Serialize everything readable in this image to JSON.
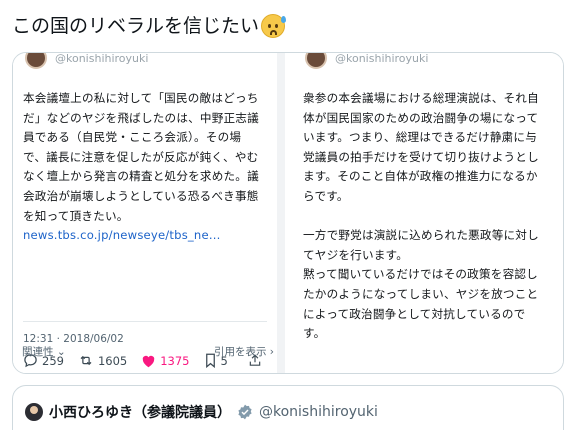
{
  "post": {
    "title": "この国のリベラルを信じたい",
    "emoji": "anxious-face-with-sweat"
  },
  "left_tweet": {
    "handle": "@konishihiroyuki",
    "lines": [
      "本会議壇上の私に対して「国民の敵はどっち",
      "だ」などのヤジを飛ばしたのは、中野正志議",
      "員である（自民党・こころ会派）。その場",
      "で、議長に注意を促したが反応が鈍く、やむ",
      "なく壇上から発言の精査と処分を求めた。議",
      "会政治が崩壊しようとしている恐るべき事態",
      "を知って頂きたい。"
    ],
    "link": "news.tbs.co.jp/newseye/tbs_ne...",
    "time": "12:31 · 2018/06/02",
    "replies": "259",
    "retweets": "1605",
    "likes": "1375",
    "bookmarks": "5",
    "related_label": "関連性",
    "show_quotes_label": "引用を表示"
  },
  "right_tweet": {
    "handle": "@konishihiroyuki",
    "para1": [
      "衆参の本会議場における総理演説は、それ自",
      "体が国民国家のための政治闘争の場になって",
      "います。つまり、総理はできるだけ静粛に与",
      "党議員の拍手だけを受けて切り抜けようとし",
      "ます。そのこと自体が政権の推進力になるか",
      "らです。"
    ],
    "para2": [
      "一方で野党は演説に込められた悪政等に対し",
      "てヤジを行います。",
      "黙って聞いているだけではその政策を容認し",
      "たかのようになってしまい、ヤジを放つこと",
      "によって政治闘争として対抗しているので",
      "す。"
    ]
  },
  "embed": {
    "name": "小西ひろゆき（参議院議員）",
    "handle": "@konishihiroyuki"
  },
  "colors": {
    "link": "#1d63c9",
    "like": "#f91880",
    "verified": "#829aab",
    "border": "#cfd9de"
  }
}
